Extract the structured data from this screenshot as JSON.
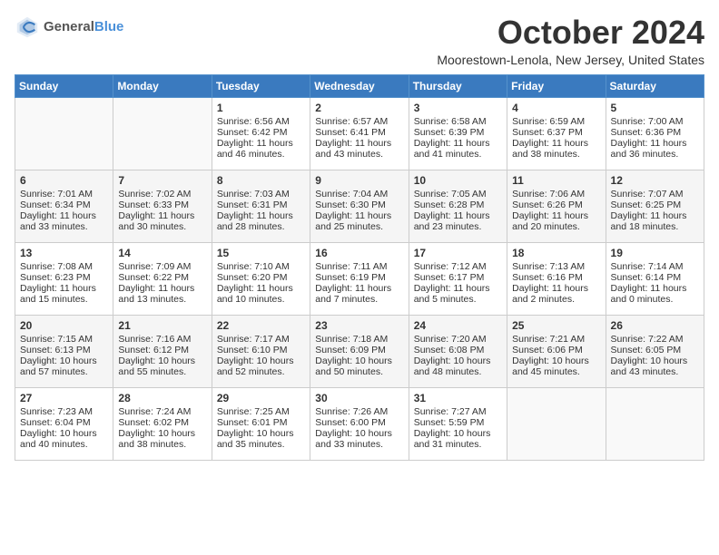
{
  "logo": {
    "general": "General",
    "blue": "Blue"
  },
  "title": "October 2024",
  "location": "Moorestown-Lenola, New Jersey, United States",
  "days_of_week": [
    "Sunday",
    "Monday",
    "Tuesday",
    "Wednesday",
    "Thursday",
    "Friday",
    "Saturday"
  ],
  "weeks": [
    [
      {
        "day": "",
        "info": ""
      },
      {
        "day": "",
        "info": ""
      },
      {
        "day": "1",
        "info": "Sunrise: 6:56 AM\nSunset: 6:42 PM\nDaylight: 11 hours and 46 minutes."
      },
      {
        "day": "2",
        "info": "Sunrise: 6:57 AM\nSunset: 6:41 PM\nDaylight: 11 hours and 43 minutes."
      },
      {
        "day": "3",
        "info": "Sunrise: 6:58 AM\nSunset: 6:39 PM\nDaylight: 11 hours and 41 minutes."
      },
      {
        "day": "4",
        "info": "Sunrise: 6:59 AM\nSunset: 6:37 PM\nDaylight: 11 hours and 38 minutes."
      },
      {
        "day": "5",
        "info": "Sunrise: 7:00 AM\nSunset: 6:36 PM\nDaylight: 11 hours and 36 minutes."
      }
    ],
    [
      {
        "day": "6",
        "info": "Sunrise: 7:01 AM\nSunset: 6:34 PM\nDaylight: 11 hours and 33 minutes."
      },
      {
        "day": "7",
        "info": "Sunrise: 7:02 AM\nSunset: 6:33 PM\nDaylight: 11 hours and 30 minutes."
      },
      {
        "day": "8",
        "info": "Sunrise: 7:03 AM\nSunset: 6:31 PM\nDaylight: 11 hours and 28 minutes."
      },
      {
        "day": "9",
        "info": "Sunrise: 7:04 AM\nSunset: 6:30 PM\nDaylight: 11 hours and 25 minutes."
      },
      {
        "day": "10",
        "info": "Sunrise: 7:05 AM\nSunset: 6:28 PM\nDaylight: 11 hours and 23 minutes."
      },
      {
        "day": "11",
        "info": "Sunrise: 7:06 AM\nSunset: 6:26 PM\nDaylight: 11 hours and 20 minutes."
      },
      {
        "day": "12",
        "info": "Sunrise: 7:07 AM\nSunset: 6:25 PM\nDaylight: 11 hours and 18 minutes."
      }
    ],
    [
      {
        "day": "13",
        "info": "Sunrise: 7:08 AM\nSunset: 6:23 PM\nDaylight: 11 hours and 15 minutes."
      },
      {
        "day": "14",
        "info": "Sunrise: 7:09 AM\nSunset: 6:22 PM\nDaylight: 11 hours and 13 minutes."
      },
      {
        "day": "15",
        "info": "Sunrise: 7:10 AM\nSunset: 6:20 PM\nDaylight: 11 hours and 10 minutes."
      },
      {
        "day": "16",
        "info": "Sunrise: 7:11 AM\nSunset: 6:19 PM\nDaylight: 11 hours and 7 minutes."
      },
      {
        "day": "17",
        "info": "Sunrise: 7:12 AM\nSunset: 6:17 PM\nDaylight: 11 hours and 5 minutes."
      },
      {
        "day": "18",
        "info": "Sunrise: 7:13 AM\nSunset: 6:16 PM\nDaylight: 11 hours and 2 minutes."
      },
      {
        "day": "19",
        "info": "Sunrise: 7:14 AM\nSunset: 6:14 PM\nDaylight: 11 hours and 0 minutes."
      }
    ],
    [
      {
        "day": "20",
        "info": "Sunrise: 7:15 AM\nSunset: 6:13 PM\nDaylight: 10 hours and 57 minutes."
      },
      {
        "day": "21",
        "info": "Sunrise: 7:16 AM\nSunset: 6:12 PM\nDaylight: 10 hours and 55 minutes."
      },
      {
        "day": "22",
        "info": "Sunrise: 7:17 AM\nSunset: 6:10 PM\nDaylight: 10 hours and 52 minutes."
      },
      {
        "day": "23",
        "info": "Sunrise: 7:18 AM\nSunset: 6:09 PM\nDaylight: 10 hours and 50 minutes."
      },
      {
        "day": "24",
        "info": "Sunrise: 7:20 AM\nSunset: 6:08 PM\nDaylight: 10 hours and 48 minutes."
      },
      {
        "day": "25",
        "info": "Sunrise: 7:21 AM\nSunset: 6:06 PM\nDaylight: 10 hours and 45 minutes."
      },
      {
        "day": "26",
        "info": "Sunrise: 7:22 AM\nSunset: 6:05 PM\nDaylight: 10 hours and 43 minutes."
      }
    ],
    [
      {
        "day": "27",
        "info": "Sunrise: 7:23 AM\nSunset: 6:04 PM\nDaylight: 10 hours and 40 minutes."
      },
      {
        "day": "28",
        "info": "Sunrise: 7:24 AM\nSunset: 6:02 PM\nDaylight: 10 hours and 38 minutes."
      },
      {
        "day": "29",
        "info": "Sunrise: 7:25 AM\nSunset: 6:01 PM\nDaylight: 10 hours and 35 minutes."
      },
      {
        "day": "30",
        "info": "Sunrise: 7:26 AM\nSunset: 6:00 PM\nDaylight: 10 hours and 33 minutes."
      },
      {
        "day": "31",
        "info": "Sunrise: 7:27 AM\nSunset: 5:59 PM\nDaylight: 10 hours and 31 minutes."
      },
      {
        "day": "",
        "info": ""
      },
      {
        "day": "",
        "info": ""
      }
    ]
  ]
}
